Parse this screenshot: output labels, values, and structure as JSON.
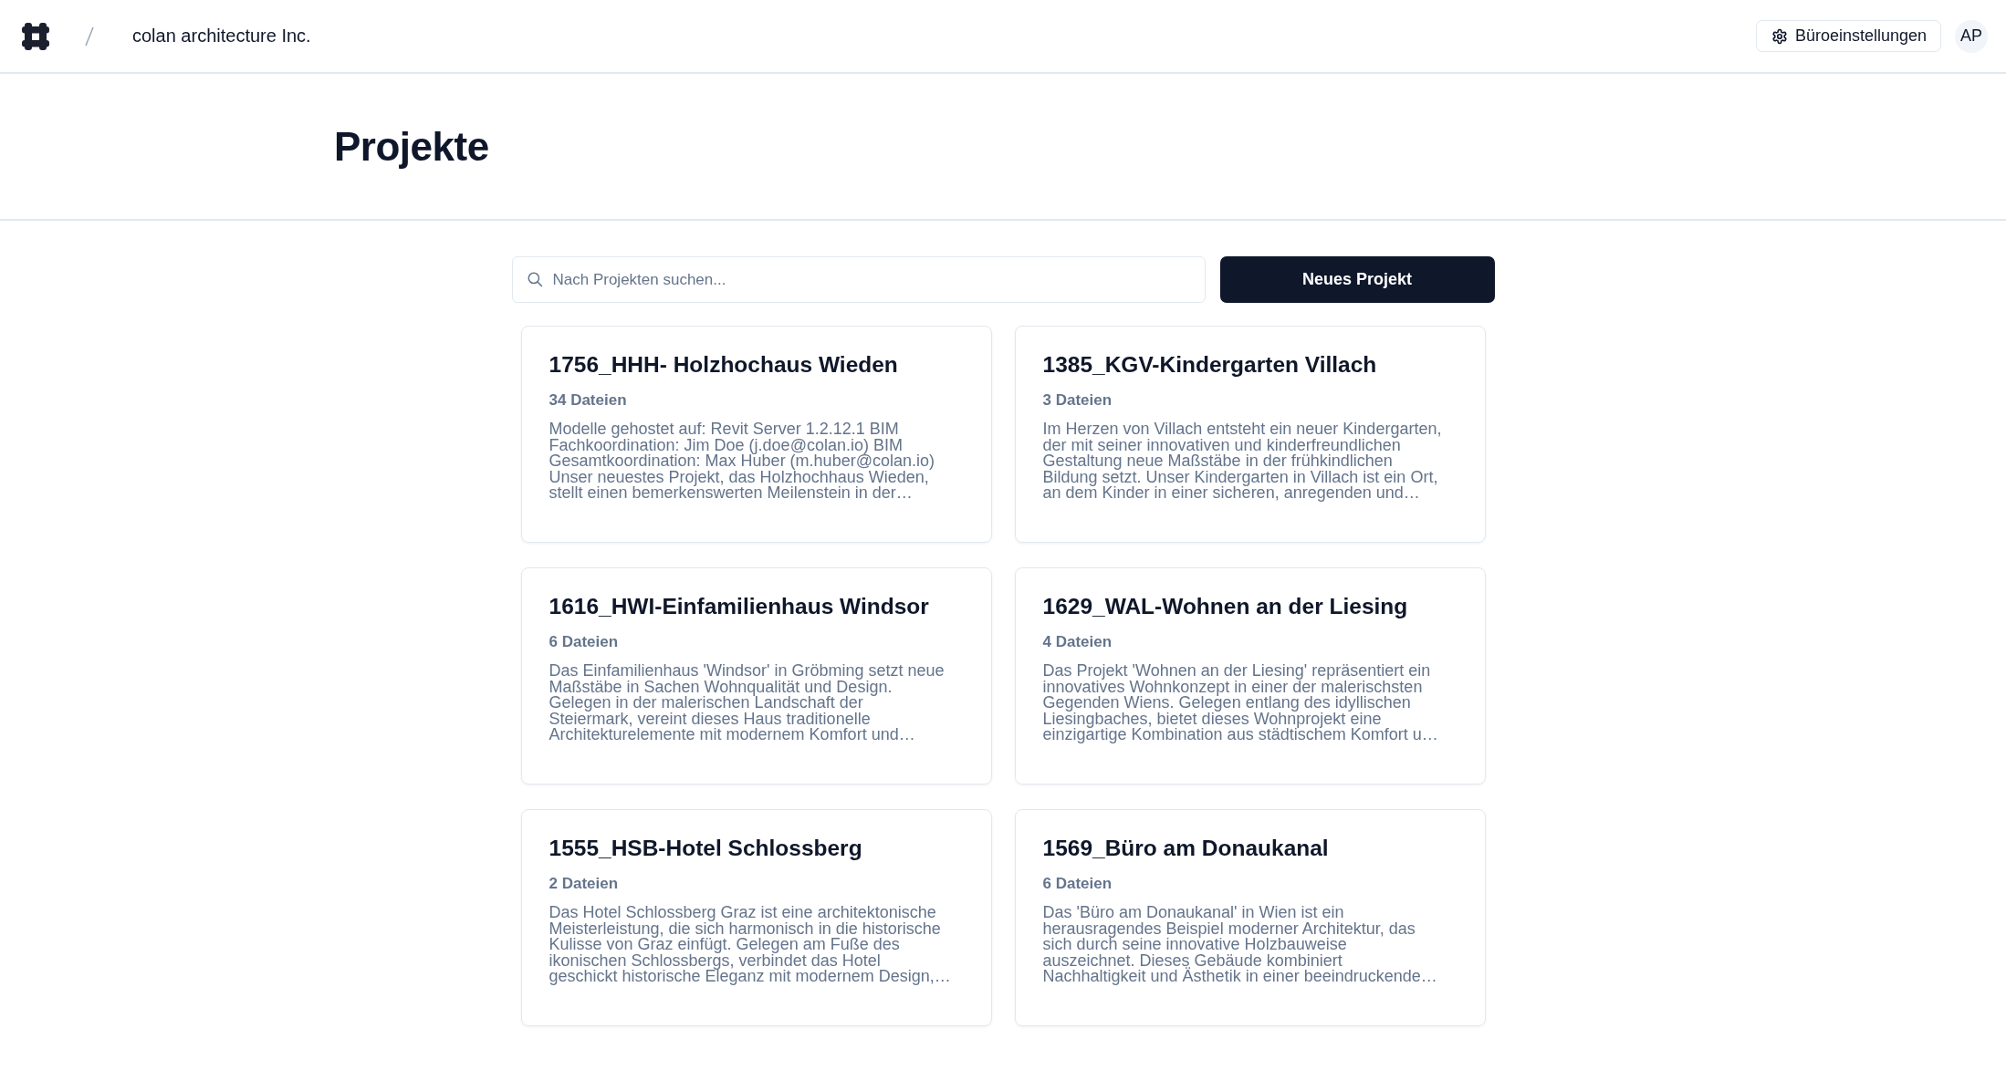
{
  "header": {
    "organization": "colan architecture Inc.",
    "settings_button": "Büroeinstellungen",
    "avatar_initials": "AP"
  },
  "page": {
    "title": "Projekte"
  },
  "search": {
    "placeholder": "Nach Projekten suchen..."
  },
  "new_project_button": "Neues Projekt",
  "projects": [
    {
      "name": "1756_HHH- Holzhochaus Wieden",
      "files": "34 Dateien",
      "description": "Modelle gehostet auf: Revit Server 1.2.12.1 BIM\nFachkoordination: Jim Doe (j.doe@colan.io) BIM\nGesamtkoordination: Max Huber (m.huber@colan.io)\nUnser neuestes Projekt, das Holzhochhaus Wieden,\nstellt einen bemerkenswerten Meilenstein in der…"
    },
    {
      "name": "1385_KGV-Kindergarten Villach",
      "files": "3 Dateien",
      "description": "Im Herzen von Villach entsteht ein neuer Kindergarten,\nder mit seiner innovativen und kinderfreundlichen\nGestaltung neue Maßstäbe in der frühkindlichen\nBildung setzt. Unser Kindergarten in Villach ist ein Ort,\nan dem Kinder in einer sicheren, anregenden und…"
    },
    {
      "name": "1616_HWI-Einfamilienhaus Windsor",
      "files": "6 Dateien",
      "description": "Das Einfamilienhaus 'Windsor' in Gröbming setzt neue\nMaßstäbe in Sachen Wohnqualität und Design.\nGelegen in der malerischen Landschaft der\nSteiermark, vereint dieses Haus traditionelle\nArchitekturelemente mit modernem Komfort und…"
    },
    {
      "name": "1629_WAL-Wohnen an der Liesing",
      "files": "4 Dateien",
      "description": "Das Projekt 'Wohnen an der Liesing' repräsentiert ein\ninnovatives Wohnkonzept in einer der malerischsten\nGegenden Wiens. Gelegen entlang des idyllischen\nLiesingbaches, bietet dieses Wohnprojekt eine\neinzigartige Kombination aus städtischem Komfort u…"
    },
    {
      "name": "1555_HSB-Hotel Schlossberg",
      "files": "2 Dateien",
      "description": "Das Hotel Schlossberg Graz ist eine architektonische\nMeisterleistung, die sich harmonisch in die historische\nKulisse von Graz einfügt. Gelegen am Fuße des\nikonischen Schlossbergs, verbindet das Hotel\ngeschickt historische Eleganz mit modernem Design,…"
    },
    {
      "name": "1569_Büro am Donaukanal",
      "files": "6 Dateien",
      "description": "Das 'Büro am Donaukanal' in Wien ist ein\nherausragendes Beispiel moderner Architektur, das\nsich durch seine innovative Holzbauweise\nauszeichnet. Dieses Gebäude kombiniert\nNachhaltigkeit und Ästhetik in einer beeindruckende…"
    }
  ]
}
